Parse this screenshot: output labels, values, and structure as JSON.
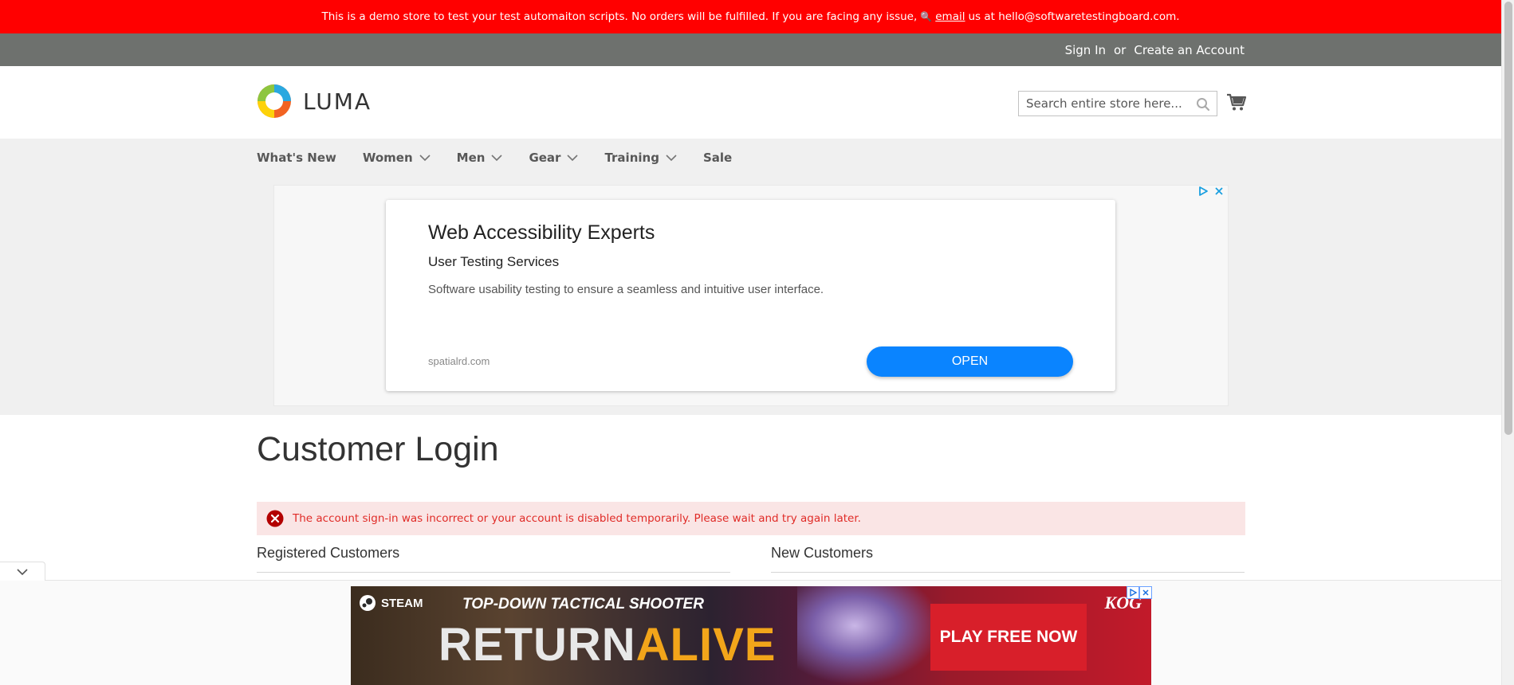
{
  "demo_banner": {
    "text_before": "This is a demo store to test your test automaiton scripts. No orders will be fulfilled. If you are facing any issue,",
    "email_link": "email",
    "text_after": "us at hello@softwaretestingboard.com."
  },
  "account_bar": {
    "sign_in": "Sign In",
    "or": "or",
    "create_account": "Create an Account"
  },
  "header": {
    "logo_text": "LUMA",
    "search_placeholder": "Search entire store here..."
  },
  "nav": {
    "items": [
      {
        "label": "What's New",
        "has_dropdown": false
      },
      {
        "label": "Women",
        "has_dropdown": true
      },
      {
        "label": "Men",
        "has_dropdown": true
      },
      {
        "label": "Gear",
        "has_dropdown": true
      },
      {
        "label": "Training",
        "has_dropdown": true
      },
      {
        "label": "Sale",
        "has_dropdown": false
      }
    ]
  },
  "ad": {
    "title": "Web Accessibility Experts",
    "subtitle": "User Testing Services",
    "description": "Software usability testing to ensure a seamless and intuitive user interface.",
    "domain": "spatialrd.com",
    "button": "OPEN",
    "button_color": "#0a84ff"
  },
  "main": {
    "title": "Customer Login",
    "error": "The account sign-in was incorrect or your account is disabled temporarily. Please wait and try again later.",
    "registered_title": "Registered Customers",
    "new_title": "New Customers"
  },
  "bottom_ad": {
    "platform": "STEAM",
    "tagline": "TOP-DOWN TACTICAL SHOOTER",
    "title_word1": "RETURN",
    "title_word2": "ALIVE",
    "cta": "PLAY FREE NOW",
    "brand": "KOG"
  },
  "colors": {
    "banner": "#ff0000",
    "account_bar": "#6e716e",
    "nav_bg": "#f0f0f0",
    "error_bg": "#fae5e5",
    "error_text": "#e02b27"
  }
}
